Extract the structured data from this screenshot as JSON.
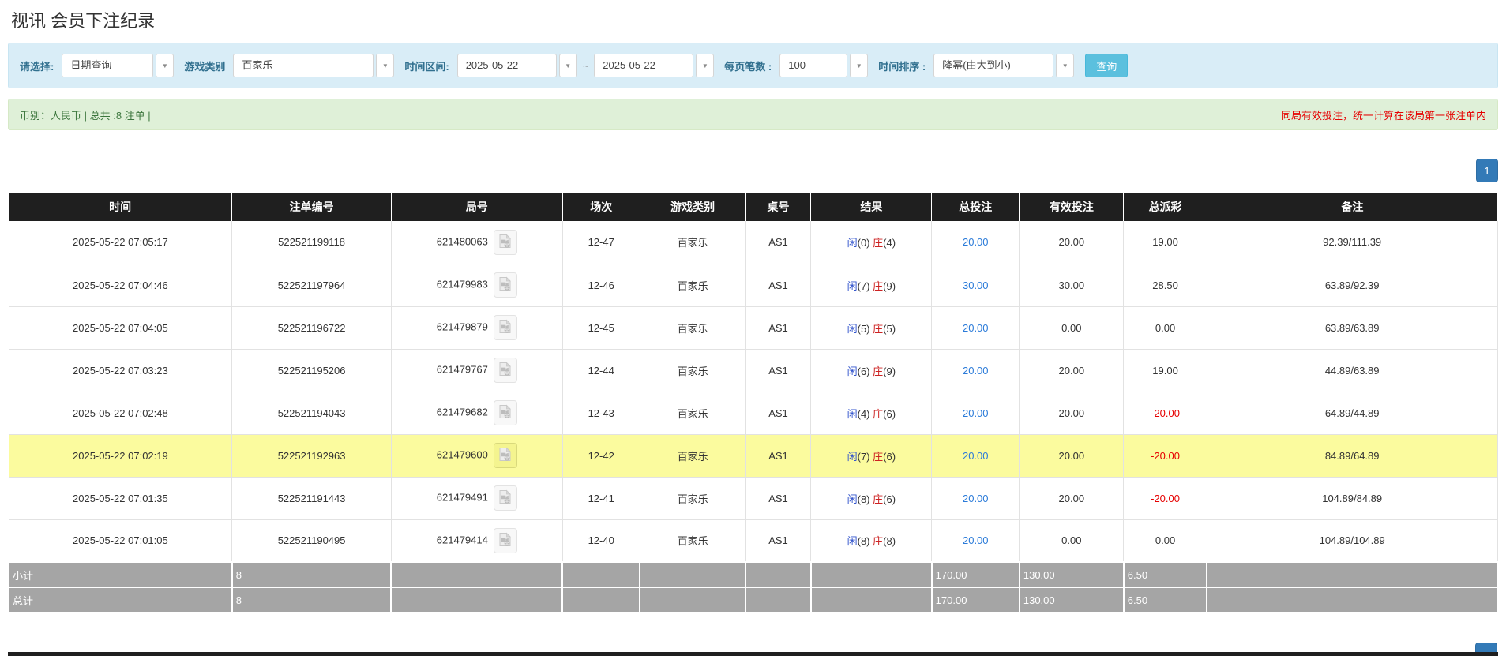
{
  "page": {
    "title": "视讯 会员下注纪录"
  },
  "filters": {
    "select_label": "请选择:",
    "select_value": "日期查询",
    "game_type_label": "游戏类别",
    "game_type_value": "百家乐",
    "time_range_label": "时间区间:",
    "date_from": "2025-05-22",
    "tilde": "~",
    "date_to": "2025-05-22",
    "per_page_label": "每页笔数 :",
    "per_page_value": "100",
    "sort_label": "时间排序 :",
    "sort_value": "降幂(由大到小)",
    "search_button": "查询",
    "caret_icon": "▼"
  },
  "summary": {
    "left": "币别：人民币 | 总共 :8 注单 |",
    "right": "同局有效投注，统一计算在该局第一张注单内"
  },
  "pagination": {
    "page": "1"
  },
  "table": {
    "columns": [
      "时间",
      "注单编号",
      "局号",
      "场次",
      "游戏类别",
      "桌号",
      "结果",
      "总投注",
      "有效投注",
      "总派彩",
      "备注"
    ],
    "rows": [
      {
        "time": "2025-05-22 07:05:17",
        "bet_id": "522521199118",
        "round_id": "621480063",
        "session": "12-47",
        "game": "百家乐",
        "table_no": "AS1",
        "p_label": "闲",
        "p_val": "(0)",
        "b_label": "庄",
        "b_val": "(4)",
        "total_bet": "20.00",
        "valid_bet": "20.00",
        "payout": "19.00",
        "payout_negative": false,
        "remark": "92.39/111.39",
        "highlight": false
      },
      {
        "time": "2025-05-22 07:04:46",
        "bet_id": "522521197964",
        "round_id": "621479983",
        "session": "12-46",
        "game": "百家乐",
        "table_no": "AS1",
        "p_label": "闲",
        "p_val": "(7)",
        "b_label": "庄",
        "b_val": "(9)",
        "total_bet": "30.00",
        "valid_bet": "30.00",
        "payout": "28.50",
        "payout_negative": false,
        "remark": "63.89/92.39",
        "highlight": false
      },
      {
        "time": "2025-05-22 07:04:05",
        "bet_id": "522521196722",
        "round_id": "621479879",
        "session": "12-45",
        "game": "百家乐",
        "table_no": "AS1",
        "p_label": "闲",
        "p_val": "(5)",
        "b_label": "庄",
        "b_val": "(5)",
        "total_bet": "20.00",
        "valid_bet": "0.00",
        "payout": "0.00",
        "payout_negative": false,
        "remark": "63.89/63.89",
        "highlight": false
      },
      {
        "time": "2025-05-22 07:03:23",
        "bet_id": "522521195206",
        "round_id": "621479767",
        "session": "12-44",
        "game": "百家乐",
        "table_no": "AS1",
        "p_label": "闲",
        "p_val": "(6)",
        "b_label": "庄",
        "b_val": "(9)",
        "total_bet": "20.00",
        "valid_bet": "20.00",
        "payout": "19.00",
        "payout_negative": false,
        "remark": "44.89/63.89",
        "highlight": false
      },
      {
        "time": "2025-05-22 07:02:48",
        "bet_id": "522521194043",
        "round_id": "621479682",
        "session": "12-43",
        "game": "百家乐",
        "table_no": "AS1",
        "p_label": "闲",
        "p_val": "(4)",
        "b_label": "庄",
        "b_val": "(6)",
        "total_bet": "20.00",
        "valid_bet": "20.00",
        "payout": "-20.00",
        "payout_negative": true,
        "remark": "64.89/44.89",
        "highlight": false
      },
      {
        "time": "2025-05-22 07:02:19",
        "bet_id": "522521192963",
        "round_id": "621479600",
        "session": "12-42",
        "game": "百家乐",
        "table_no": "AS1",
        "p_label": "闲",
        "p_val": "(7)",
        "b_label": "庄",
        "b_val": "(6)",
        "total_bet": "20.00",
        "valid_bet": "20.00",
        "payout": "-20.00",
        "payout_negative": true,
        "remark": "84.89/64.89",
        "highlight": true
      },
      {
        "time": "2025-05-22 07:01:35",
        "bet_id": "522521191443",
        "round_id": "621479491",
        "session": "12-41",
        "game": "百家乐",
        "table_no": "AS1",
        "p_label": "闲",
        "p_val": "(8)",
        "b_label": "庄",
        "b_val": "(6)",
        "total_bet": "20.00",
        "valid_bet": "20.00",
        "payout": "-20.00",
        "payout_negative": true,
        "remark": "104.89/84.89",
        "highlight": false
      },
      {
        "time": "2025-05-22 07:01:05",
        "bet_id": "522521190495",
        "round_id": "621479414",
        "session": "12-40",
        "game": "百家乐",
        "table_no": "AS1",
        "p_label": "闲",
        "p_val": "(8)",
        "b_label": "庄",
        "b_val": "(8)",
        "total_bet": "20.00",
        "valid_bet": "0.00",
        "payout": "0.00",
        "payout_negative": false,
        "remark": "104.89/104.89",
        "highlight": false
      }
    ],
    "subtotal": {
      "label": "小计",
      "count": "8",
      "total_bet": "170.00",
      "valid_bet": "130.00",
      "payout": "6.50"
    },
    "total": {
      "label": "总计",
      "count": "8",
      "total_bet": "170.00",
      "valid_bet": "130.00",
      "payout": "6.50"
    }
  }
}
